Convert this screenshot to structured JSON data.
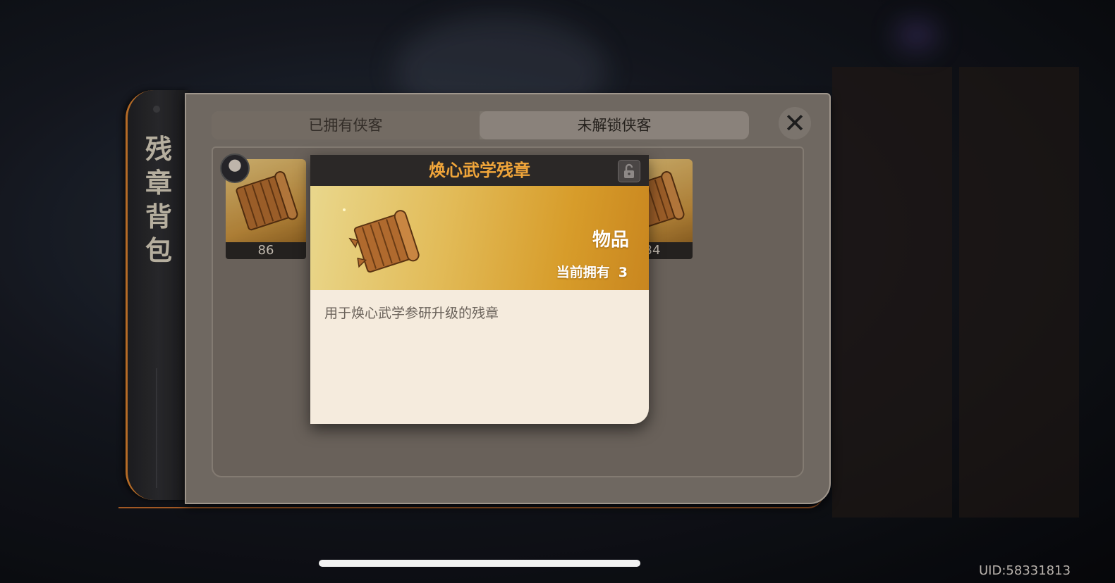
{
  "side_title": [
    "残",
    "章",
    "背",
    "包"
  ],
  "tabs": {
    "owned": "已拥有侠客",
    "locked": "未解锁侠客"
  },
  "close_icon": "close-x-icon",
  "cards": [
    {
      "count": "86"
    },
    {
      "count": "34"
    }
  ],
  "popup": {
    "title": "焕心武学残章",
    "type": "物品",
    "owned_label": "当前拥有",
    "owned_value": "3",
    "description": "用于焕心武学参研升级的残章",
    "lock_icon": "unlock-icon"
  },
  "uid": "UID:58331813",
  "colors": {
    "title_orange": "#f0a53a",
    "accent_orange": "#cf7a2c",
    "banner_gold": "#d79c2a"
  }
}
